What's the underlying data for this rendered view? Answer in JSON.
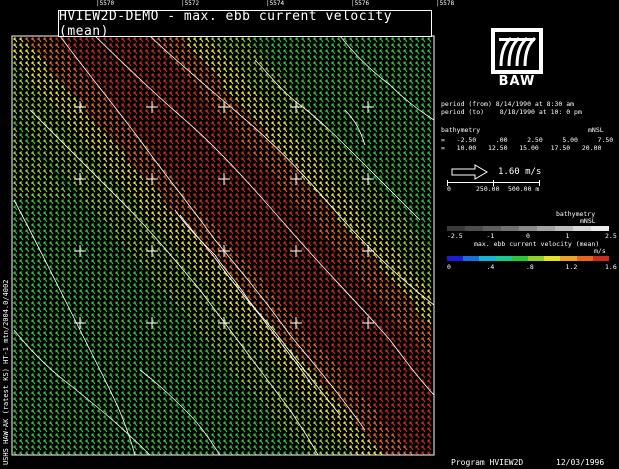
{
  "title": "HVIEW2D-DEMO - max. ebb current velocity (mean)",
  "logo_text": "BAW",
  "period": {
    "from": "period (from) 8/14/1990 at 8:30 am",
    "to": "period (to)    8/18/1990 at 10: 0 pm"
  },
  "bathymetry_header": {
    "left": "bathymetry",
    "right": "mNSL"
  },
  "bathymetry_rows": [
    "=   -2.50     .00     2.50     5.00     7.50",
    "=   10.00   12.50   15.00   17.50   20.00"
  ],
  "vector_scale": {
    "label": "1.60 m/s"
  },
  "distance_scale": {
    "labels": [
      "0",
      "250.00",
      "500.00 m"
    ]
  },
  "bathy_colorbar": {
    "title": "bathymetry",
    "unit": "mNSL",
    "ticks": [
      "-2.5",
      "-1",
      "0",
      "1",
      "2.5"
    ],
    "colors": [
      "#3a3a3a",
      "#4d4d4d",
      "#5e5e5e",
      "#727272",
      "#8a8a8a",
      "#a3a3a3",
      "#bdbdbd",
      "#d6d6d6",
      "#ececec"
    ]
  },
  "velocity_colorbar": {
    "title": "max. ebb current velocity (mean)",
    "unit": "m/s",
    "ticks": [
      "0",
      ".4",
      ".8",
      "1.2",
      "1.6"
    ],
    "colors": [
      "#1b1bd8",
      "#1c6de0",
      "#18b4d6",
      "#19c98d",
      "#2dc43a",
      "#8fd12a",
      "#e6e22a",
      "#f0a12a",
      "#e8641f",
      "#cc2a1c"
    ]
  },
  "side_label": "USHS HAW-AK (ratest KS)   HT-1 mtn/2004.0/4002",
  "footer": {
    "program": "Program  HVIEW2D",
    "date": "12/03/1996"
  },
  "top_ticks": [
    "5570",
    "5572",
    "5574",
    "5576",
    "5578"
  ],
  "colors": {
    "background": "#000000",
    "vector_red": "#cc2a1c",
    "vector_orange": "#e8641f",
    "vector_yellow": "#e6e22a",
    "vector_green": "#2dc43a",
    "contour": "#ffffff"
  }
}
